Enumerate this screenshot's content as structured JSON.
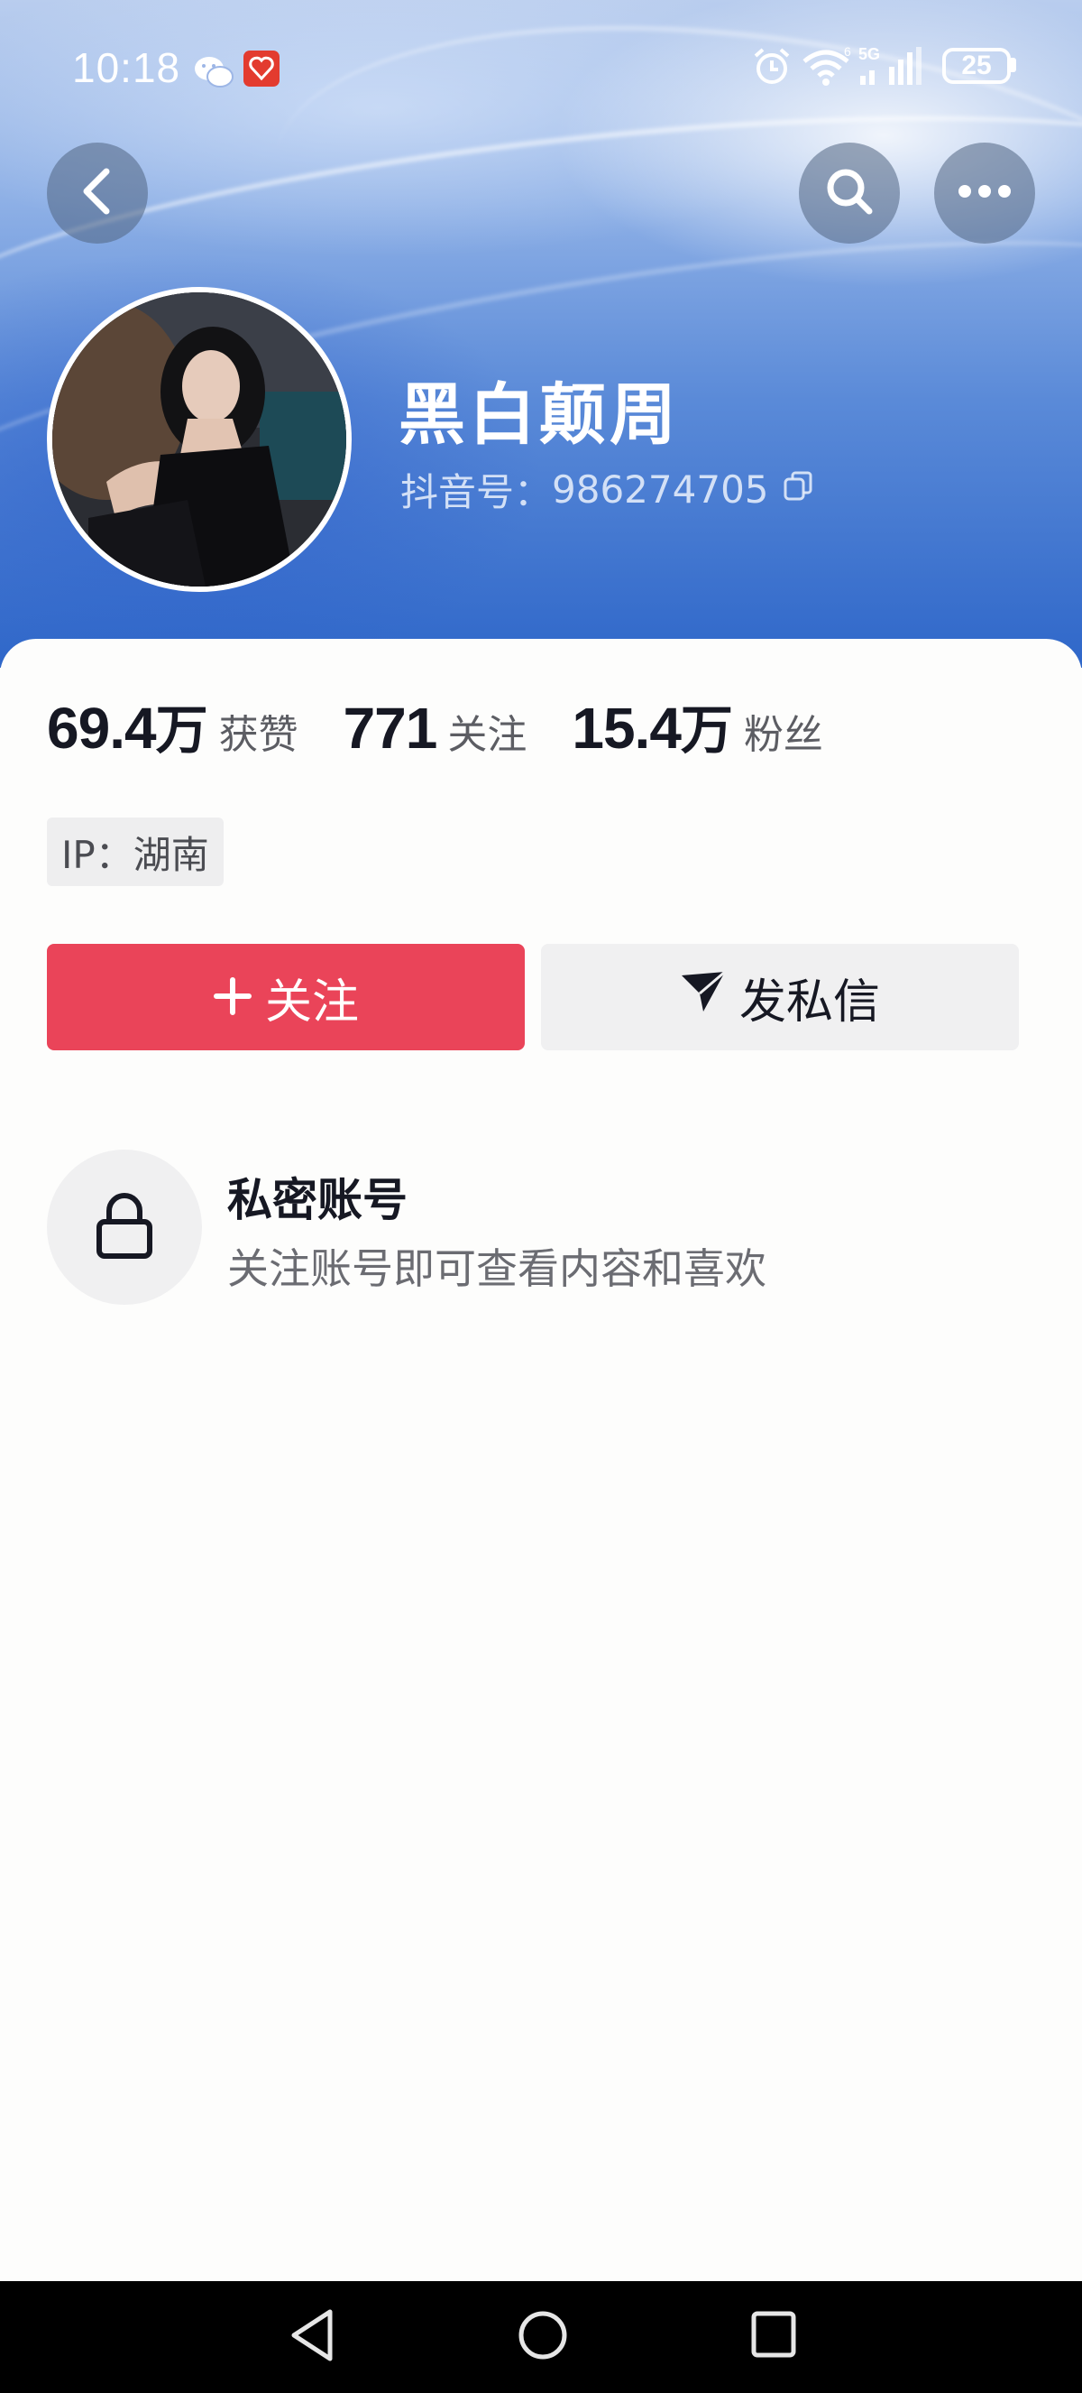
{
  "status_bar": {
    "time": "10:18",
    "battery": "25",
    "icons": [
      "wechat-icon",
      "app-notification-icon",
      "alarm-icon",
      "wifi-icon",
      "5g-signal-icon",
      "battery-icon"
    ]
  },
  "nav": {
    "back_icon": "chevron-left-icon",
    "search_icon": "search-icon",
    "more_icon": "more-horizontal-icon"
  },
  "profile": {
    "name": "黑白颠周",
    "account_id_label": "抖音号：",
    "account_id": "986274705"
  },
  "stats": [
    {
      "num": "69.4",
      "unit": "万",
      "label": "获赞"
    },
    {
      "num": "771",
      "unit": "",
      "label": "关注"
    },
    {
      "num": "15.4",
      "unit": "万",
      "label": "粉丝"
    }
  ],
  "ip_location": "IP：湖南",
  "actions": {
    "follow_label": "关注",
    "message_label": "发私信"
  },
  "private_notice": {
    "title": "私密账号",
    "description": "关注账号即可查看内容和喜欢"
  },
  "colors": {
    "accent_red": "#ea4459",
    "text_primary": "#161823",
    "text_secondary": "#6b6c72",
    "button_gray": "#f0f0f1"
  }
}
